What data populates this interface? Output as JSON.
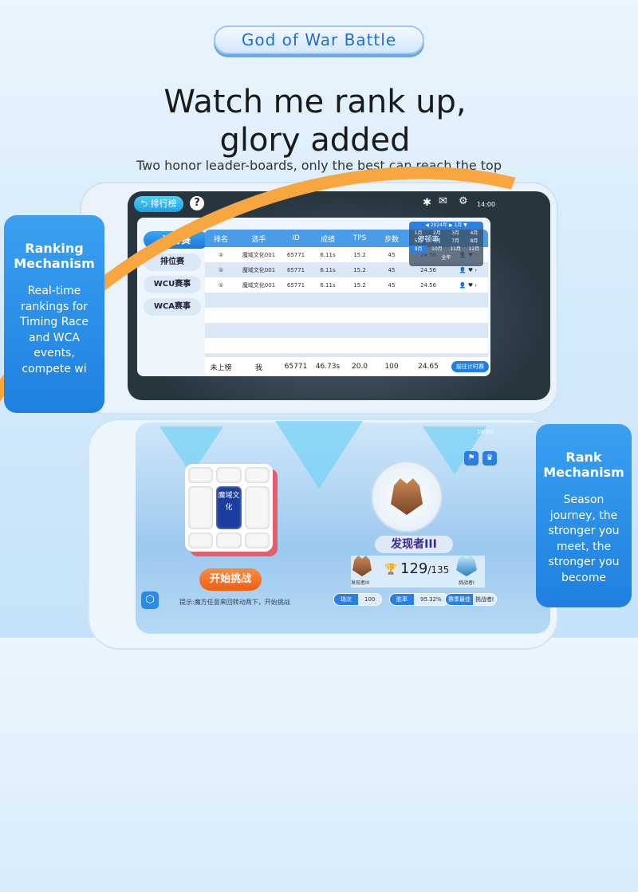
{
  "banner": {
    "pill": "God of War Battle",
    "headline_1": "Watch me rank up,",
    "headline_2": "glory added",
    "subtitle": "Two honor leader-boards, only the best can reach the top"
  },
  "left_callout": {
    "title": "Ranking Mechanism",
    "body": "Real-time rankings for Timing Race and WCA events, compete wi"
  },
  "right_callout": {
    "title": "Rank Mechanism",
    "body": "Season journey, the stronger you meet, the stronger you become"
  },
  "top_screen": {
    "back_label": "排行榜",
    "help": "?",
    "time": "14:00",
    "tabs": [
      "计时赛",
      "排位赛",
      "WCU赛事",
      "WCA赛事"
    ],
    "columns": [
      "排名",
      "选手",
      "ID",
      "成绩",
      "TPS",
      "步数",
      "停顿率"
    ],
    "rows": [
      [
        "①",
        "魔域文化001",
        "65771",
        "6.11s",
        "15.2",
        "45",
        "24.56"
      ],
      [
        "①",
        "魔域文化001",
        "65771",
        "6.11s",
        "15.2",
        "45",
        "24.56"
      ],
      [
        "①",
        "魔域文化001",
        "65771",
        "6.11s",
        "15.2",
        "45",
        "24.56"
      ]
    ],
    "footer": [
      "未上榜",
      "我",
      "65771",
      "46.73s",
      "20.0",
      "100",
      "24.65"
    ],
    "footer_button": "前往计时赛",
    "picker": {
      "year": "2024年",
      "month": "1月",
      "months": [
        "1月",
        "2月",
        "3月",
        "4月",
        "5月",
        "6月",
        "7月",
        "8月",
        "9月",
        "10月",
        "11月",
        "12月"
      ],
      "all": "全年"
    }
  },
  "bottom_screen": {
    "time": "14:00",
    "cube_logo": "魔域文化",
    "start_button": "开始挑战",
    "hint": "提示:魔方任意来回转动两下，开始挑战",
    "rank_name": "发现者III",
    "score": "129",
    "score_total": "/135",
    "left_rank": "发现者III",
    "right_rank": "挑战者I",
    "stats": [
      {
        "label": "场次",
        "value": "100"
      },
      {
        "label": "胜率",
        "value": "95.32%"
      },
      {
        "label": "赛季最佳",
        "value": "挑战者I"
      }
    ]
  },
  "colors": {
    "accent": "#1f80e0",
    "orange": "#ec5f15",
    "swirl": "#f7a640"
  }
}
